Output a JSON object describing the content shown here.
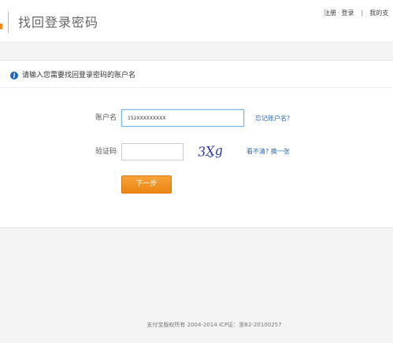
{
  "header": {
    "title": "找回登录密码",
    "links": {
      "register": "注册",
      "separator_dot": "·",
      "login": "登录",
      "separator_bar": "|",
      "my_partial": "我的支"
    }
  },
  "notice": {
    "icon": "info-icon",
    "icon_glyph": "i",
    "text": "请输入您需要找回登录密码的账户名"
  },
  "form": {
    "account_label": "账户名",
    "account_value": "152XXXXXXXXX",
    "forgot_account_link": "忘记账户名?",
    "captcha_label": "验证码",
    "captcha_value": "",
    "captcha_text": "3Xg",
    "refresh_captcha_link": "看不清? 换一张",
    "next_button": "下一步"
  },
  "footer": {
    "copyright": "支付宝版权所有 2004-2014 ICP证：浙B2-20100257"
  },
  "colors": {
    "accent_orange": "#f0891f",
    "link_blue": "#2a6bb2",
    "captcha_blue": "#2f3d9e",
    "info_blue": "#1a67b0"
  }
}
